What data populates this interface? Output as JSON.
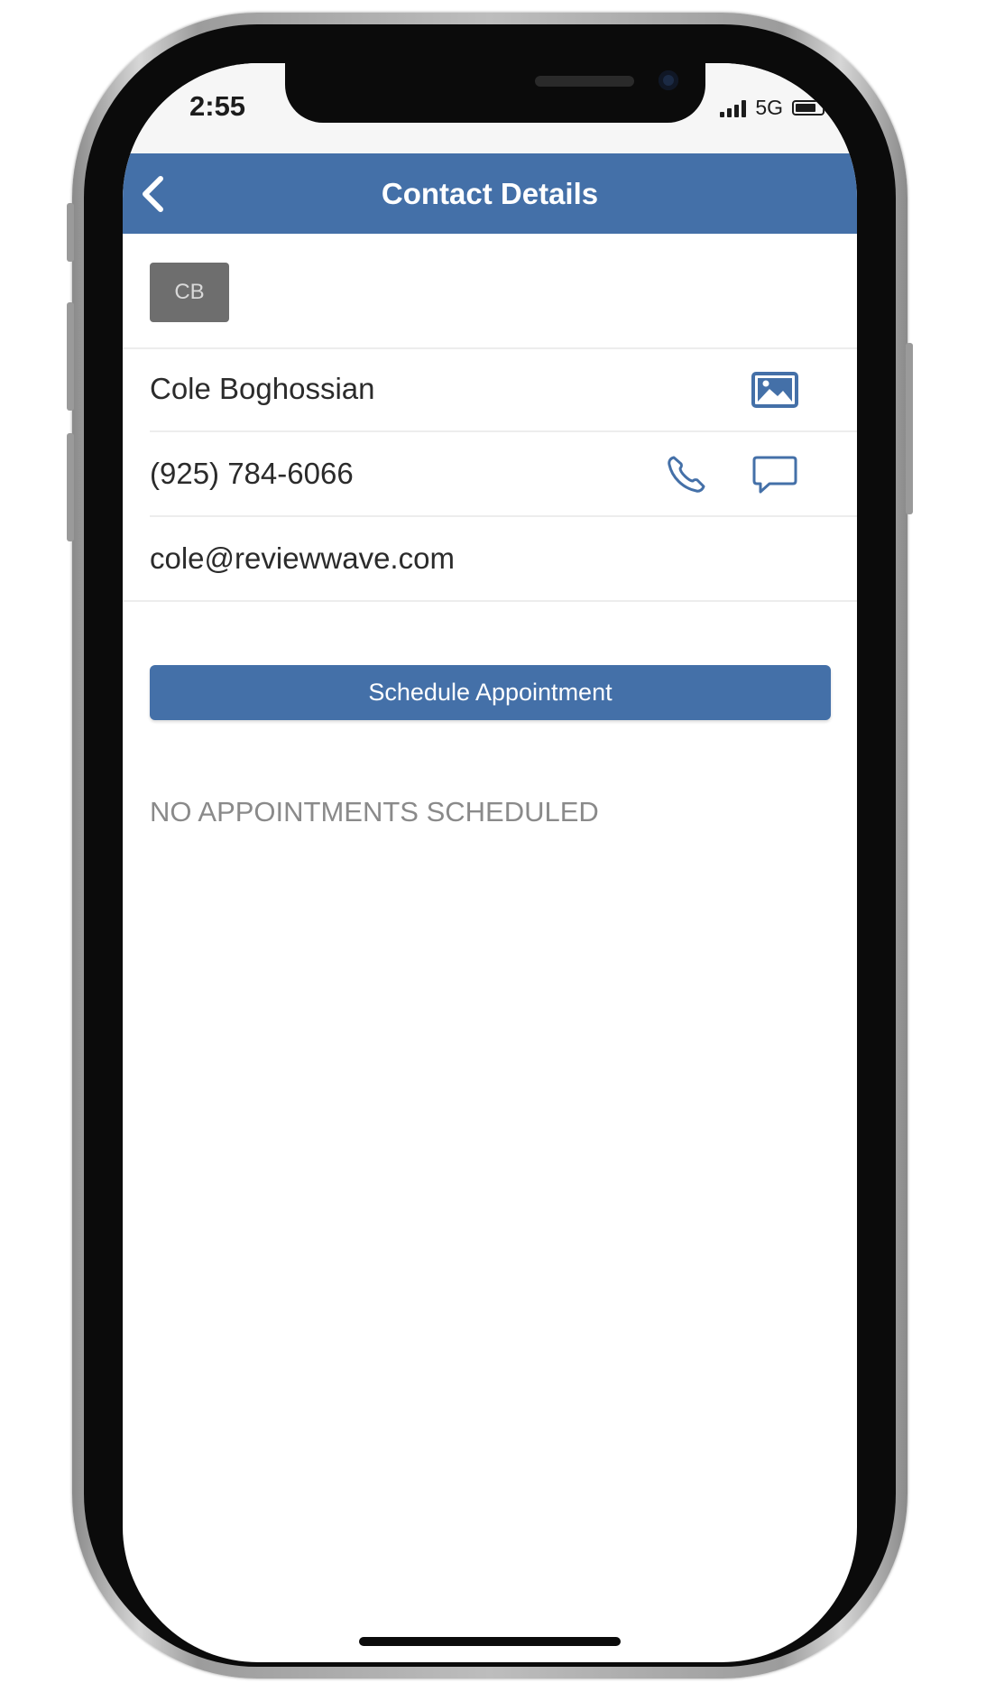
{
  "status_bar": {
    "time": "2:55",
    "network": "5G",
    "signal_icon": "signal-bars-icon",
    "battery_icon": "battery-icon"
  },
  "header": {
    "title": "Contact Details",
    "back_icon": "chevron-left-icon",
    "background": "#4470a8"
  },
  "contact": {
    "initials": "CB",
    "name": "Cole Boghossian",
    "phone": "(925) 784-6066",
    "email": "cole@reviewwave.com",
    "name_action_icon": "image-icon",
    "phone_actions": [
      "phone-icon",
      "message-bubble-icon"
    ]
  },
  "actions": {
    "schedule_label": "Schedule Appointment"
  },
  "appointments": {
    "empty_message": "NO APPOINTMENTS SCHEDULED"
  },
  "colors": {
    "accent": "#4470a8",
    "avatar_bg": "#6e6e6e",
    "muted_text": "#8a8a8a"
  }
}
